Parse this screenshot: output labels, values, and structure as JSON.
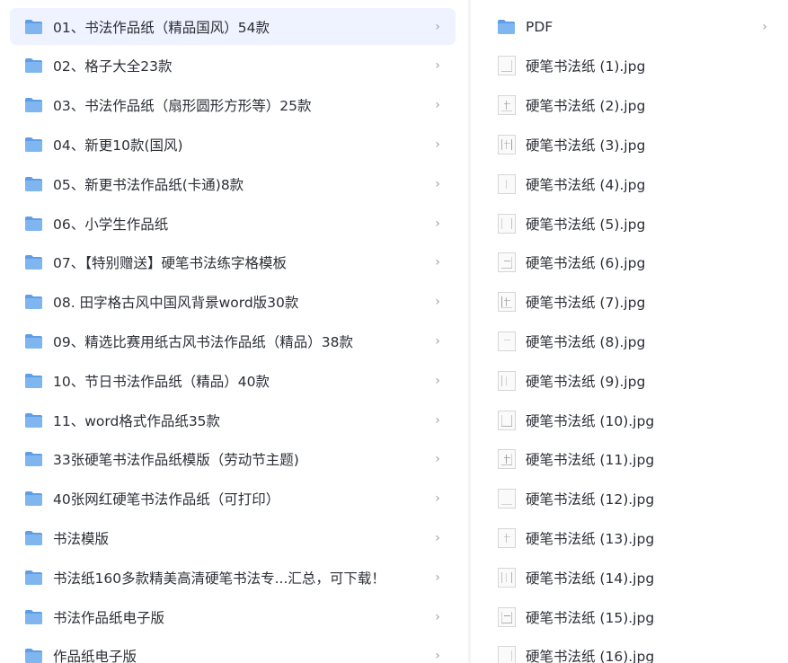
{
  "left_list": {
    "items": [
      {
        "label": "01、书法作品纸（精品国风）54款",
        "selected": true
      },
      {
        "label": "02、格子大全23款"
      },
      {
        "label": "03、书法作品纸（扇形圆形方形等）25款"
      },
      {
        "label": "04、新更10款(国风)"
      },
      {
        "label": "05、新更书法作品纸(卡通)8款"
      },
      {
        "label": "06、小学生作品纸"
      },
      {
        "label": "07、【特别赠送】硬笔书法练字格模板"
      },
      {
        "label": "08. 田字格古风中国风背景word版30款"
      },
      {
        "label": "09、精选比赛用纸古风书法作品纸（精品）38款"
      },
      {
        "label": "10、节日书法作品纸（精品）40款"
      },
      {
        "label": "11、word格式作品纸35款"
      },
      {
        "label": "33张硬笔书法作品纸模版（劳动节主题)"
      },
      {
        "label": "40张网红硬笔书法作品纸（可打印）"
      },
      {
        "label": "书法模版"
      },
      {
        "label": "书法纸160多款精美高清硬笔书法专...汇总，可下载！"
      },
      {
        "label": "书法作品纸电子版"
      },
      {
        "label": "作品纸电子版"
      }
    ]
  },
  "right_list": {
    "folder": {
      "label": "PDF"
    },
    "files": [
      {
        "label": "硬笔书法纸 (1).jpg"
      },
      {
        "label": "硬笔书法纸 (2).jpg"
      },
      {
        "label": "硬笔书法纸 (3).jpg"
      },
      {
        "label": "硬笔书法纸 (4).jpg"
      },
      {
        "label": "硬笔书法纸 (5).jpg"
      },
      {
        "label": "硬笔书法纸 (6).jpg"
      },
      {
        "label": "硬笔书法纸 (7).jpg"
      },
      {
        "label": "硬笔书法纸 (8).jpg"
      },
      {
        "label": "硬笔书法纸 (9).jpg"
      },
      {
        "label": "硬笔书法纸 (10).jpg"
      },
      {
        "label": "硬笔书法纸 (11).jpg"
      },
      {
        "label": "硬笔书法纸 (12).jpg"
      },
      {
        "label": "硬笔书法纸 (13).jpg"
      },
      {
        "label": "硬笔书法纸 (14).jpg"
      },
      {
        "label": "硬笔书法纸 (15).jpg"
      },
      {
        "label": "硬笔书法纸 (16).jpg"
      }
    ]
  },
  "icons": {
    "folder": "folder-icon",
    "image": "image-file-icon",
    "chevron": "chevron-right-icon"
  },
  "colors": {
    "folder": "#7fb6f0",
    "folder_tab": "#5f9ee6",
    "selected_bg": "#eff2ff",
    "text": "#2b2f36",
    "chevron": "#9aa0a6"
  },
  "glyphs": {
    "chevron": "›"
  }
}
